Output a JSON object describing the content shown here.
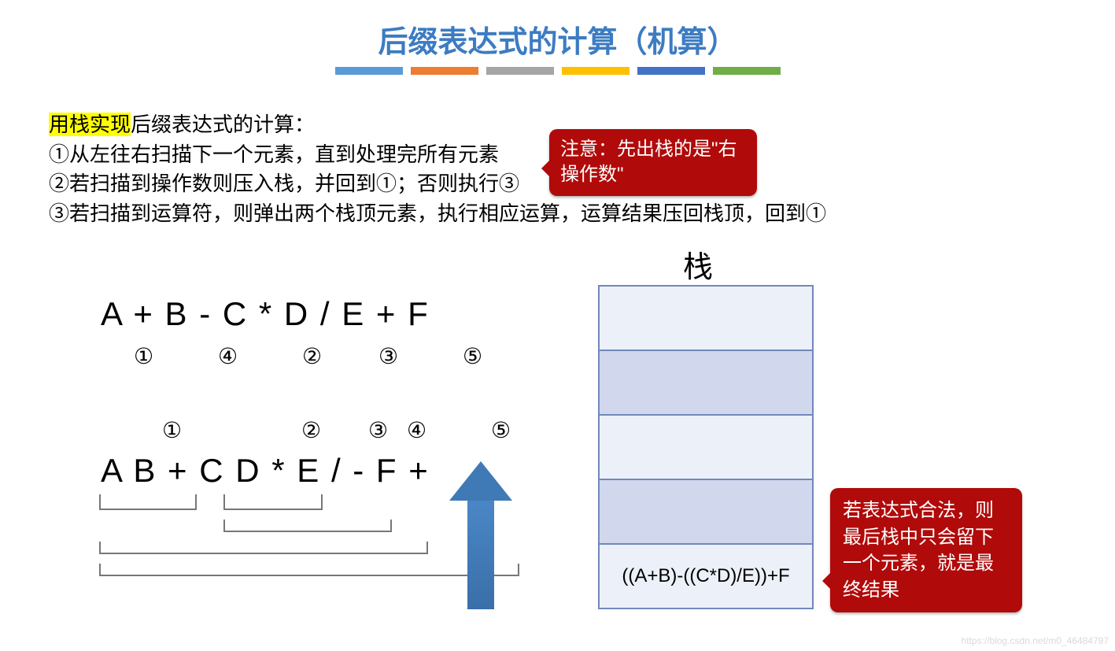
{
  "title": "后缀表达式的计算（机算）",
  "intro": {
    "highlight": "用栈实现",
    "rest0": "后缀表达式的计算：",
    "line1": "①从左往右扫描下一个元素，直到处理完所有元素",
    "line2": "②若扫描到操作数则压入栈，并回到①；否则执行③",
    "line3": "③若扫描到运算符，则弹出两个栈顶元素，执行相应运算，运算结果压回栈顶，回到①"
  },
  "callout_top": "注意：先出栈的是\"右操作数\"",
  "infix_expression": "A + B - C * D / E + F",
  "infix_order": [
    "①",
    "④",
    "②",
    "③",
    "⑤"
  ],
  "postfix_order": [
    "①",
    "②",
    "③",
    "④",
    "⑤"
  ],
  "postfix_expression": "A B + C D * E / - F +",
  "stack_label": "栈",
  "stack_cells": [
    "",
    "",
    "",
    "",
    "((A+B)-((C*D)/E))+F"
  ],
  "callout_right": "若表达式合法，则最后栈中只会留下一个元素，就是最终结果",
  "watermark": "https://blog.csdn.net/m0_46484797"
}
